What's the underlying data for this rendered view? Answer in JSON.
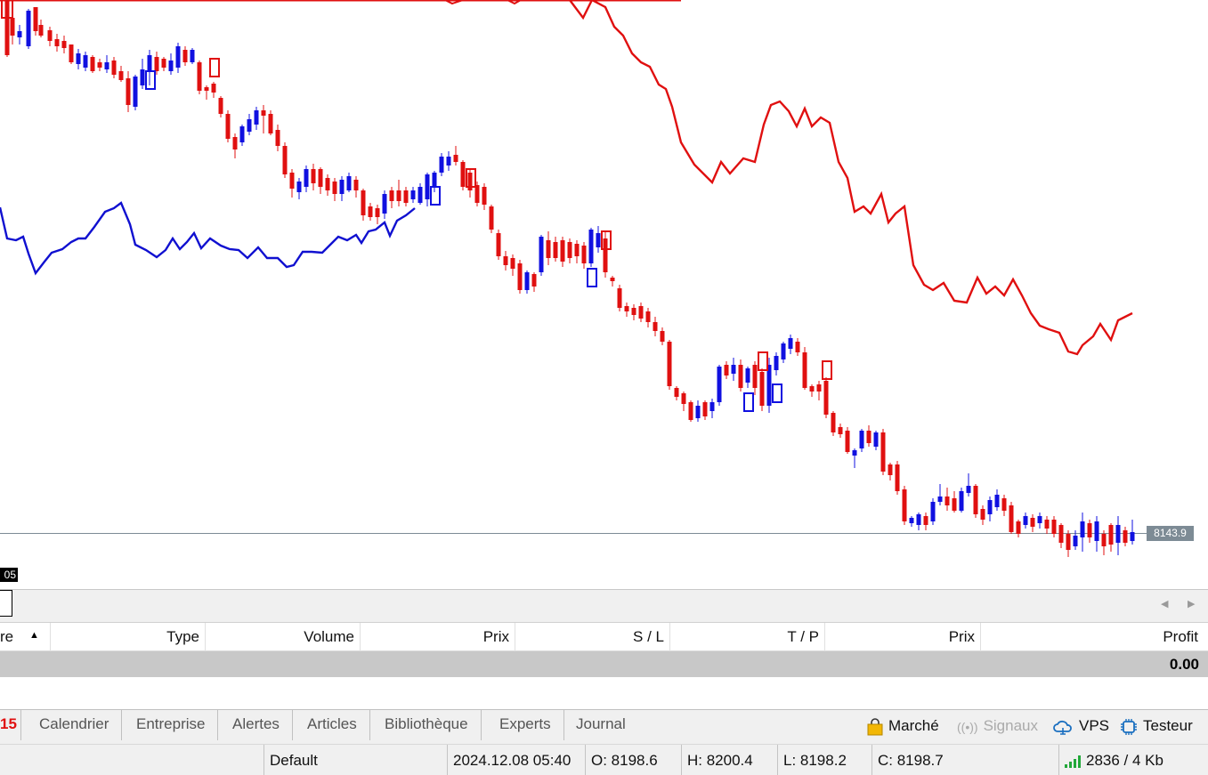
{
  "chart": {
    "current_price_label": "8143.9",
    "time_label": "05",
    "colors": {
      "bull": "#1010e0",
      "bear": "#e01010",
      "line_red": "#e01010",
      "line_blue": "#1010d0",
      "price_line": "#7d8b95"
    },
    "candles_note": ""
  },
  "table": {
    "headers": [
      "re",
      "Type",
      "Volume",
      "Prix",
      "S / L",
      "T / P",
      "Prix",
      "Profit"
    ],
    "total_profit": "0.00"
  },
  "bottom_tabs": {
    "cut_label": "15",
    "tabs": [
      "Calendrier",
      "Entreprise",
      "Alertes",
      "Articles",
      "Bibliothèque",
      "Experts",
      "Journal"
    ],
    "market": "Marché",
    "signals": "Signaux",
    "vps": "VPS",
    "tester": "Testeur"
  },
  "status": {
    "profile": "Default",
    "datetime": "2024.12.08 05:40",
    "open": "O: 8198.6",
    "high": "H: 8200.4",
    "low": "L: 8198.2",
    "close": "C: 8198.7",
    "traffic": "2836 / 4 Kb"
  }
}
